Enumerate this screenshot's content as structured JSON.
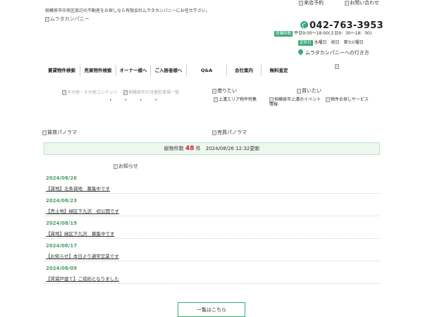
{
  "header": {
    "tagline": "相模原市中央区周辺の不動産をお探しなら有限会社ムラタカンパニーにお任せ下さい。",
    "logo_alt": "ムラタカンパニー",
    "visit_link": "来店予約",
    "contact_link": "お問い合わせ",
    "phone": "042-763-3953",
    "hours_label": "営業時間",
    "hours_text": "平日9:00～18:00(土日9：30～18：00)",
    "closed_label": "定休日",
    "closed_text": "水曜日　祝日　第3火曜日",
    "directions_link": "ムラタカンパニーへの行き方"
  },
  "nav": {
    "items": [
      "賃貸物件検索",
      "売買物件検索",
      "オーナー様へ",
      "ご入居者様へ",
      "Q&A",
      "会社案内",
      "無料査定"
    ]
  },
  "slider": {
    "caption_left": "その他・その他コンテンツ",
    "caption_right": "相模原市の月極駐車場一覧",
    "dots": "• • • •"
  },
  "links": {
    "rent_want": "借りたい",
    "buy_want": "買いたい",
    "kamimizo_area": "上溝エリア物件特集",
    "kamimizo_events": "相模原市上溝のイベント情報",
    "property_search_service": "物件お探しサービス"
  },
  "panorama": {
    "rent": "賃貸パノラマ",
    "sale": "売買パノラマ"
  },
  "stats": {
    "prefix": "総物件数",
    "count": "48",
    "suffix": "件　2024/08/26 12:32更新"
  },
  "news": {
    "heading_alt": "お知らせ",
    "items": [
      {
        "date": "2024/08/26",
        "title": "【貸地】北条貸地　募集中です"
      },
      {
        "date": "2024/08/23",
        "title": "【売土地】緑区下九沢　初公開です"
      },
      {
        "date": "2024/08/19",
        "title": "【貸地】緑区下九沢　募集中です"
      },
      {
        "date": "2024/08/17",
        "title": "【お知らせ】本日より通常営業です"
      },
      {
        "date": "2024/08/09",
        "title": "【賃貸戸建て】ご成約となりました"
      }
    ],
    "more_button": "一覧はこちら"
  },
  "colors": {
    "accent": "#3aa97a",
    "count_red": "#d2202a",
    "stats_bg": "#eef7ee"
  }
}
